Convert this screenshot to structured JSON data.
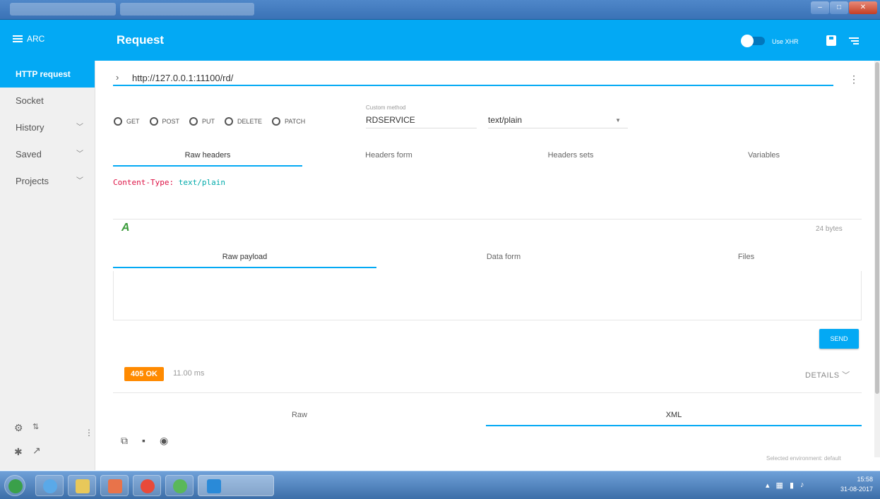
{
  "app": {
    "menu_label": "ARC",
    "page_title": "Request",
    "use_xhr_label": "Use XHR"
  },
  "sidebar": {
    "items": [
      {
        "label": "HTTP request",
        "active": true
      },
      {
        "label": "Socket"
      },
      {
        "label": "History",
        "expandable": true
      },
      {
        "label": "Saved",
        "expandable": true
      },
      {
        "label": "Projects",
        "expandable": true
      }
    ]
  },
  "request": {
    "url": "http://127.0.0.1:11100/rd/",
    "methods": [
      "GET",
      "POST",
      "PUT",
      "DELETE",
      "PATCH"
    ],
    "custom_method_label": "Custom method",
    "custom_method_value": "RDSERVICE",
    "content_type": "text/plain",
    "header_tabs": [
      "Raw headers",
      "Headers form",
      "Headers sets",
      "Variables"
    ],
    "header_key": "Content-Type:",
    "header_value": "text/plain",
    "payload_size": "24 bytes",
    "payload_tabs": [
      "Raw payload",
      "Data form",
      "Files"
    ],
    "send_label": "SEND"
  },
  "response": {
    "status": "405 OK",
    "time": "11.00 ms",
    "details_label": "DETAILS",
    "tabs": [
      "Raw",
      "XML"
    ]
  },
  "footer": {
    "environment": "Selected environment: default"
  },
  "taskbar": {
    "time": "15:58",
    "date": "31-08-2017"
  },
  "colors": {
    "accent": "#03a9f4",
    "status_badge": "#ff8a00"
  }
}
